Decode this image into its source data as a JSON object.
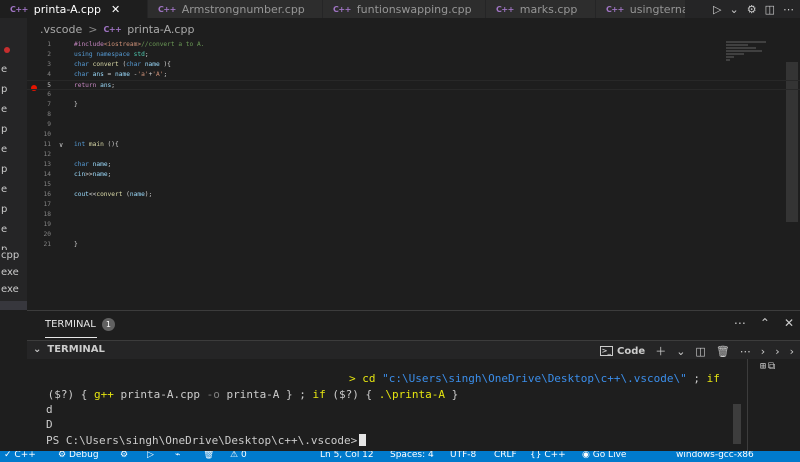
{
  "tabs": [
    {
      "icon": "C++",
      "label": "printa-A.cpp",
      "active": true,
      "close": "✕"
    },
    {
      "icon": "C++",
      "label": "Armstrongnumber.cpp",
      "active": false
    },
    {
      "icon": "C++",
      "label": "funtionswapping.cpp",
      "active": false
    },
    {
      "icon": "C++",
      "label": "marks.cpp",
      "active": false
    },
    {
      "icon": "C++",
      "label": "usingternar",
      "active": false
    }
  ],
  "sidebar": {
    "items": [
      "e",
      "p",
      "e",
      "p",
      "e",
      "p",
      "e",
      "p",
      "e",
      "p",
      "e",
      "cpp",
      "exe",
      "exe",
      ""
    ]
  },
  "breadcrumb": {
    "folder": ".vscode",
    "separator": ">",
    "file_icon": "C++",
    "file": "printa-A.cpp"
  },
  "editor": {
    "lines": [
      {
        "n": "1",
        "html": "<span class=\"p\">#include</span><span class=\"s\">&lt;iostream&gt;</span><span class=\"c\">//convert a to A.</span>"
      },
      {
        "n": "2",
        "html": "<span class=\"k\">using</span> <span class=\"k\">namespace</span> <span class=\"t\">std</span>;"
      },
      {
        "n": "3",
        "html": "<span class=\"k\">char</span> <span class=\"f\">convert</span> (<span class=\"k\">char</span> <span class=\"v\">name</span> ){"
      },
      {
        "n": "4",
        "html": "<span class=\"k\">char</span> <span class=\"v\">ans</span> = <span class=\"v\">name</span> -<span class=\"s\">'a'</span>+<span class=\"s\">'A'</span>;"
      },
      {
        "n": "5",
        "html": "<span class=\"p\">return</span> <span class=\"v\">ans</span>;",
        "current": true
      },
      {
        "n": "6",
        "html": ""
      },
      {
        "n": "7",
        "html": "}"
      },
      {
        "n": "8",
        "html": ""
      },
      {
        "n": "9",
        "html": ""
      },
      {
        "n": "10",
        "html": ""
      },
      {
        "n": "11",
        "html": "<span class=\"k\">int</span> <span class=\"f\">main</span> (){",
        "fold": "∨"
      },
      {
        "n": "12",
        "html": ""
      },
      {
        "n": "13",
        "html": "<span class=\"k\">char</span> <span class=\"v\">name</span>;"
      },
      {
        "n": "14",
        "html": "<span class=\"v\">cin</span>&gt;&gt;<span class=\"v\">name</span>;"
      },
      {
        "n": "15",
        "html": ""
      },
      {
        "n": "16",
        "html": "<span class=\"v\">cout</span>&lt;&lt;<span class=\"f\">convert</span> (<span class=\"v\">name</span>);"
      },
      {
        "n": "17",
        "html": ""
      },
      {
        "n": "18",
        "html": ""
      },
      {
        "n": "19",
        "html": ""
      },
      {
        "n": "20",
        "html": ""
      },
      {
        "n": "21",
        "html": "}"
      }
    ]
  },
  "panel": {
    "tab_label": "TERMINAL",
    "tab_badge": "1",
    "terminal_title": "TERMINAL",
    "profile_label": "Code"
  },
  "terminal": {
    "cmd_prompt": "> ",
    "cmd": "cd",
    "cmd_path": "\"c:\\Users\\singh\\OneDrive\\Desktop\\c++\\.vscode\\\"",
    "cmd_sep": " ; ",
    "cmd_if": "if",
    "line2_a": " ($?) { ",
    "line2_gpp": "g++",
    "line2_b": " printa-A.cpp ",
    "line2_o": "-o",
    "line2_c": " printa-A } ; ",
    "line2_if": "if",
    "line2_d": " ($?) { ",
    "line2_run": ".\\printa-A",
    "line2_e": " }",
    "output1": "d",
    "output2": "D",
    "prompt": "PS C:\\Users\\singh\\OneDrive\\Desktop\\c++\\.vscode>"
  },
  "statusbar": {
    "lang_left": "C++",
    "debug": "Debug",
    "errors": "0",
    "position": "Ln 5, Col 12",
    "spaces": "Spaces: 4",
    "encoding": "UTF-8",
    "eol": "CRLF",
    "language": "C++",
    "golive": "Go Live",
    "compiler": "windows-gcc-x86"
  },
  "colors": {
    "accent": "#007acc",
    "editor_bg": "#1e1e1e",
    "keyword": "#569cd6"
  }
}
